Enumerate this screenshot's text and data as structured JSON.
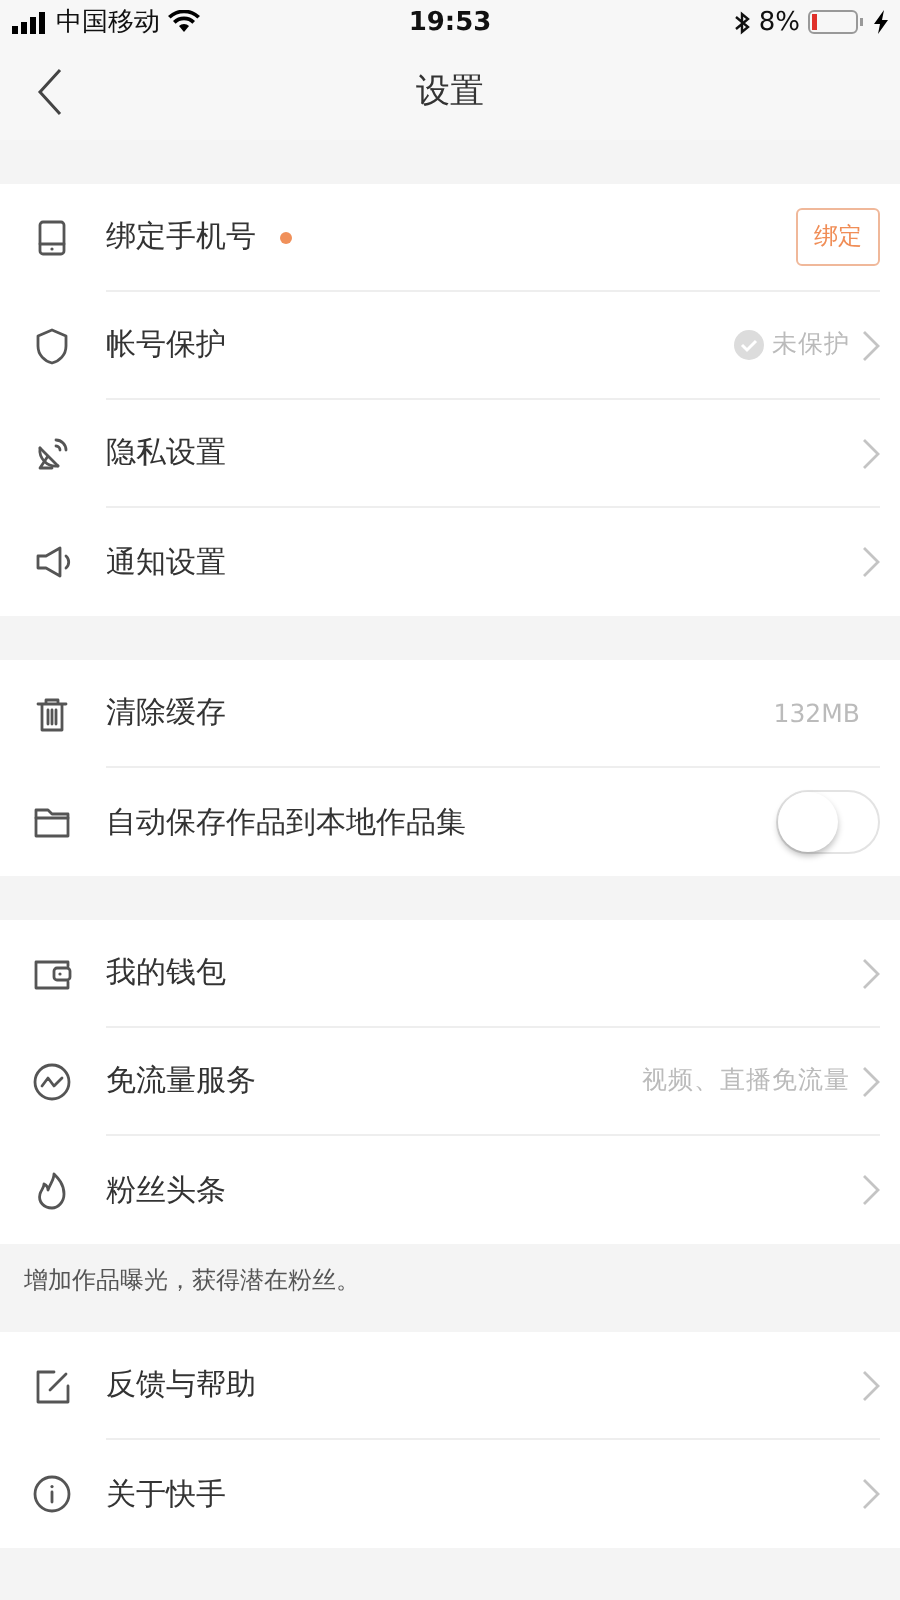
{
  "status_bar": {
    "carrier": "中国移动",
    "time": "19:53",
    "battery": "8%"
  },
  "nav": {
    "title": "设置"
  },
  "groups": [
    {
      "rows": [
        {
          "kind": "button",
          "label": "绑定手机号",
          "badge_dot": true,
          "button": "绑定"
        },
        {
          "kind": "status",
          "label": "帐号保护",
          "value": "未保护",
          "verified": false
        },
        {
          "kind": "link",
          "label": "隐私设置"
        },
        {
          "kind": "link",
          "label": "通知设置"
        }
      ]
    },
    {
      "rows": [
        {
          "kind": "value",
          "label": "清除缓存",
          "value": "132MB"
        },
        {
          "kind": "toggle",
          "label": "自动保存作品到本地作品集",
          "on": false
        }
      ]
    },
    {
      "rows": [
        {
          "kind": "link",
          "label": "我的钱包"
        },
        {
          "kind": "link",
          "label": "免流量服务",
          "value": "视频、直播免流量"
        },
        {
          "kind": "link",
          "label": "粉丝头条"
        }
      ],
      "note": "增加作品曝光，获得潜在粉丝。"
    },
    {
      "rows": [
        {
          "kind": "link",
          "label": "反馈与帮助"
        },
        {
          "kind": "link",
          "label": "关于快手"
        }
      ]
    }
  ]
}
